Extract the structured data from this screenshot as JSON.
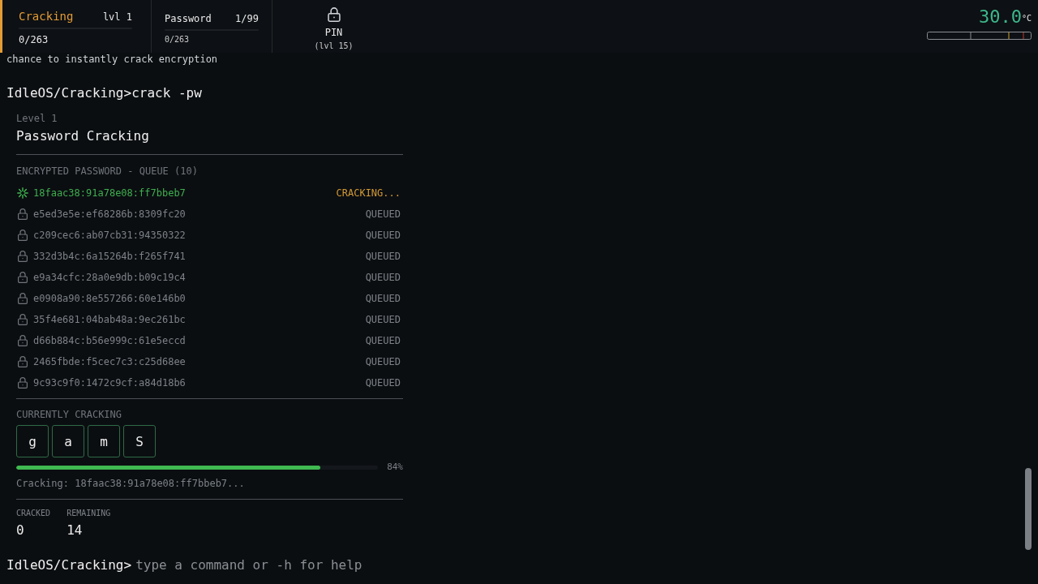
{
  "header": {
    "tabs": [
      {
        "kind": "category",
        "title": "Cracking",
        "right_label": "lvl 1",
        "progress": "0/263",
        "selected": true
      },
      {
        "kind": "skill",
        "title": "Password",
        "right_label": "1/99",
        "progress": "0/263",
        "selected": false
      },
      {
        "kind": "locked",
        "title": "PIN",
        "requirement": "(lvl 15)",
        "selected": false
      }
    ],
    "temperature": {
      "value": "30.0",
      "unit": "°C"
    }
  },
  "terminal": {
    "output": "chance to instantly crack encryption",
    "command": {
      "prompt": "IdleOS/Cracking>",
      "text": "crack -pw"
    },
    "panel": {
      "level_label": "Level 1",
      "title": "Password Cracking",
      "queue_title": "ENCRYPTED PASSWORD - QUEUE (10)",
      "queue": [
        {
          "kind": "cracking",
          "hash": "18faac38:91a78e08:ff7bbeb7",
          "status": "CRACKING..."
        },
        {
          "kind": "queued",
          "hash": "e5ed3e5e:ef68286b:8309fc20",
          "status": "QUEUED"
        },
        {
          "kind": "queued",
          "hash": "c209cec6:ab07cb31:94350322",
          "status": "QUEUED"
        },
        {
          "kind": "queued",
          "hash": "332d3b4c:6a15264b:f265f741",
          "status": "QUEUED"
        },
        {
          "kind": "queued",
          "hash": "e9a34cfc:28a0e9db:b09c19c4",
          "status": "QUEUED"
        },
        {
          "kind": "queued",
          "hash": "e0908a90:8e557266:60e146b0",
          "status": "QUEUED"
        },
        {
          "kind": "queued",
          "hash": "35f4e681:04bab48a:9ec261bc",
          "status": "QUEUED"
        },
        {
          "kind": "queued",
          "hash": "d66b884c:b56e999c:61e5eccd",
          "status": "QUEUED"
        },
        {
          "kind": "queued",
          "hash": "2465fbde:f5cec7c3:c25d68ee",
          "status": "QUEUED"
        },
        {
          "kind": "queued",
          "hash": "9c93c9f0:1472c9cf:a84d18b6",
          "status": "QUEUED"
        }
      ],
      "current": {
        "label": "CURRENTLY CRACKING",
        "chars": [
          "g",
          "a",
          "m",
          "S"
        ],
        "progress": {
          "level": 0.84,
          "reading": "84%"
        },
        "caption": "Cracking: 18faac38:91a78e08:ff7bbeb7..."
      },
      "stats": [
        {
          "label": "CRACKED",
          "value": "0"
        },
        {
          "label": "REMAINING",
          "value": "14"
        }
      ]
    },
    "input": {
      "prompt": "IdleOS/Cracking>",
      "placeholder": "type a command or -h for help"
    }
  }
}
